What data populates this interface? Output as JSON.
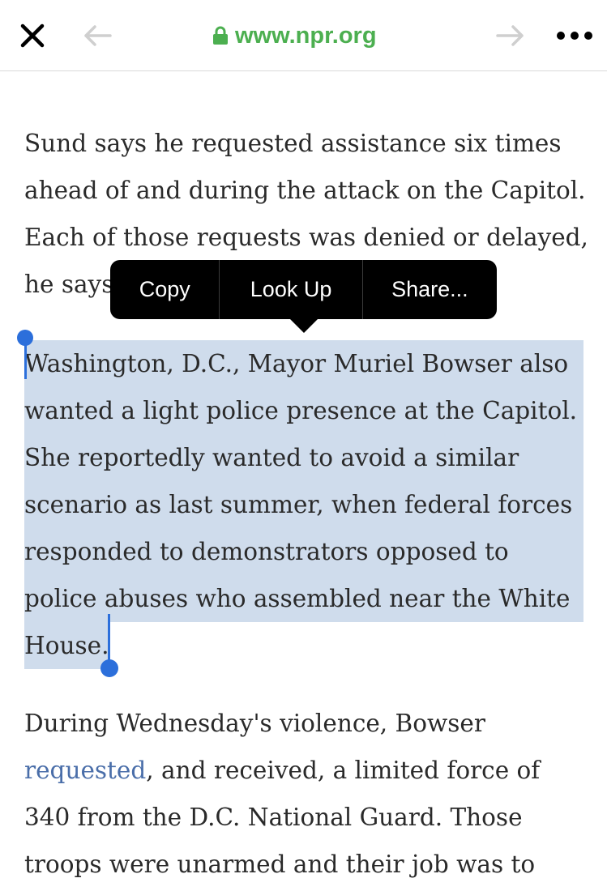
{
  "browser": {
    "url": "www.npr.org",
    "accent_color": "#4caf50",
    "icons": {
      "close": "close-icon",
      "back": "arrow-left-icon",
      "forward": "arrow-right-icon",
      "more": "more-horizontal-icon",
      "lock": "lock-icon"
    }
  },
  "article": {
    "p1": [
      "Sund says he requested assistance six times",
      "ahead of and during the attack on the Capitol.",
      "Each of those requests was denied or delayed,",
      "he says."
    ],
    "p2": [
      "Washington, D.C., Mayor Muriel Bowser also",
      "wanted a light police presence at the Capitol.",
      "She reportedly wanted to avoid a similar",
      "scenario as last summer, when federal forces",
      "responded to demonstrators opposed to",
      "police abuses who assembled near the White",
      "House."
    ],
    "p3": {
      "line1": "During Wednesday's violence, Bowser",
      "link_text": "requested",
      "line2_rest": ", and received, a limited force of",
      "line3": "340 from the D.C. National Guard. Those",
      "line4": "troops were unarmed and their job was to"
    }
  },
  "context_menu": {
    "copy": "Copy",
    "look_up": "Look Up",
    "share": "Share..."
  },
  "colors": {
    "selection": "#cfdcec",
    "handle": "#2c6fdb",
    "link": "#4a6ea9"
  }
}
